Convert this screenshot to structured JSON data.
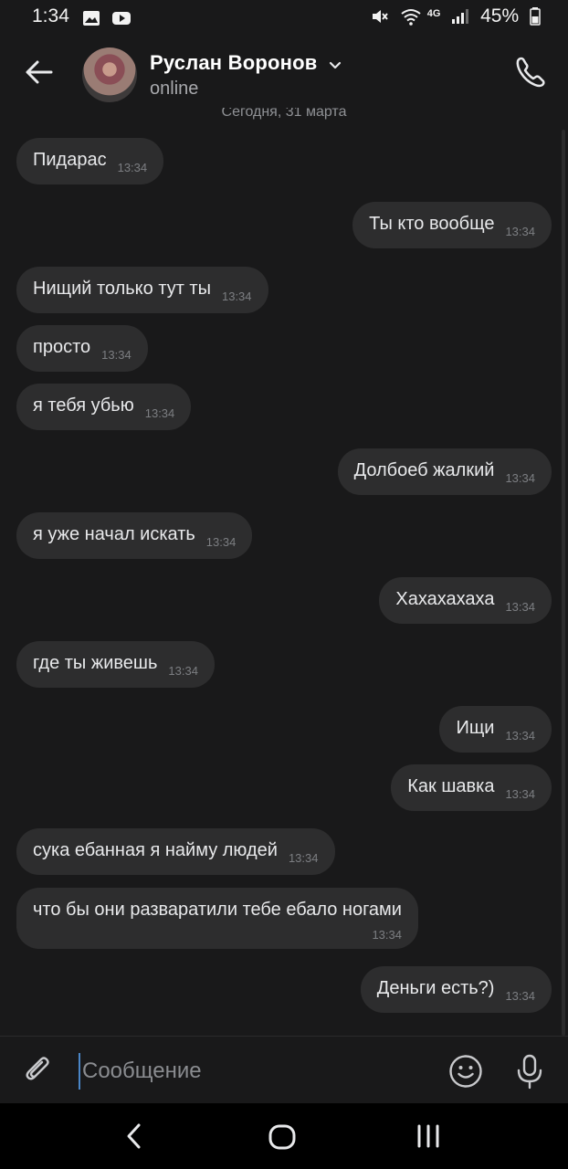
{
  "status_bar": {
    "time": "1:34",
    "network": "4G",
    "battery": "45%"
  },
  "header": {
    "contact_name": "Руслан Воронов",
    "contact_status": "online"
  },
  "chat": {
    "date_separator": "Сегодня, 31 марта",
    "messages": [
      {
        "direction": "in",
        "text": "Пидарас",
        "time": "13:34"
      },
      {
        "direction": "out",
        "text": "Ты кто вообще",
        "time": "13:34"
      },
      {
        "direction": "in",
        "text": "Нищий только тут ты",
        "time": "13:34"
      },
      {
        "direction": "in",
        "text": "просто",
        "time": "13:34"
      },
      {
        "direction": "in",
        "text": "я тебя убью",
        "time": "13:34"
      },
      {
        "direction": "out",
        "text": "Долбоеб жалкий",
        "time": "13:34"
      },
      {
        "direction": "in",
        "text": "я уже начал искать",
        "time": "13:34"
      },
      {
        "direction": "out",
        "text": "Хахахахаха",
        "time": "13:34"
      },
      {
        "direction": "in",
        "text": "где ты живешь",
        "time": "13:34"
      },
      {
        "direction": "out",
        "text": "Ищи",
        "time": "13:34"
      },
      {
        "direction": "out",
        "text": "Как шавка",
        "time": "13:34"
      },
      {
        "direction": "in",
        "text": "сука ебанная я найму людей",
        "time": "13:34"
      },
      {
        "direction": "in",
        "text": "что бы они разваратили тебе ебало ногами",
        "time": "13:34"
      },
      {
        "direction": "out",
        "text": "Деньги есть?)",
        "time": "13:34"
      }
    ]
  },
  "composer": {
    "placeholder": "Сообщение"
  },
  "icons": {
    "back": "arrow-left-icon",
    "call": "phone-icon",
    "attach": "paperclip-icon",
    "emoji": "smiley-icon",
    "mic": "microphone-icon"
  },
  "colors": {
    "background": "#19191a",
    "bubble": "#2d2d2e",
    "text": "#e8e9eb",
    "meta": "#7c7e82",
    "cursor": "#4a86c7"
  }
}
